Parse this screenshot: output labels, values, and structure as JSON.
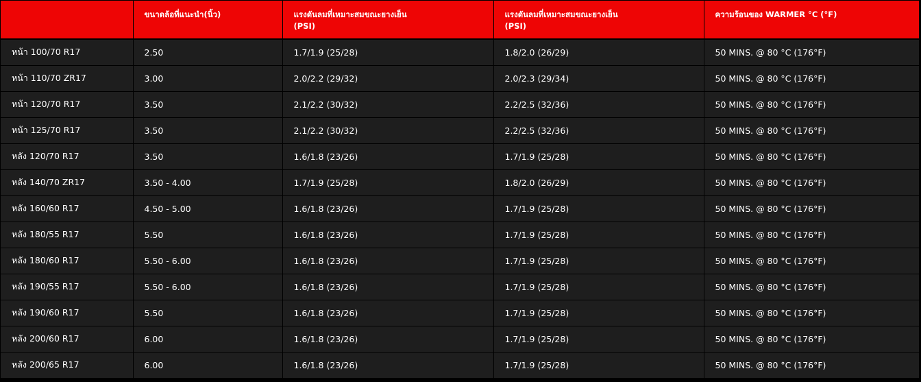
{
  "table": {
    "headers": [
      "",
      "ขนาดล้อที่แนะนำ(นิ้ว)",
      "แรงดันลมที่เหมาะสมขณะยางเย็น\n(PSI)",
      "แรงดันลมที่เหมาะสมขณะยางเย็น\n(PSI)",
      "ความร้อนของ WARMER °C (°F)"
    ],
    "rows": [
      [
        "หน้า 100/70 R17",
        "2.50",
        "1.7/1.9 (25/28)",
        "1.8/2.0 (26/29)",
        "50 MINS. @ 80 °C (176°F)"
      ],
      [
        "หน้า 110/70 ZR17",
        "3.00",
        "2.0/2.2 (29/32)",
        "2.0/2.3 (29/34)",
        "50 MINS. @ 80 °C (176°F)"
      ],
      [
        "หน้า 120/70 R17",
        "3.50",
        "2.1/2.2 (30/32)",
        "2.2/2.5 (32/36)",
        "50 MINS. @ 80 °C (176°F)"
      ],
      [
        "หน้า 125/70 R17",
        "3.50",
        "2.1/2.2 (30/32)",
        "2.2/2.5 (32/36)",
        "50 MINS. @ 80 °C (176°F)"
      ],
      [
        "หลัง 120/70 R17",
        "3.50",
        "1.6/1.8 (23/26)",
        "1.7/1.9 (25/28)",
        "50 MINS. @ 80 °C (176°F)"
      ],
      [
        "หลัง 140/70 ZR17",
        "3.50 - 4.00",
        "1.7/1.9 (25/28)",
        "1.8/2.0 (26/29)",
        "50 MINS. @ 80 °C (176°F)"
      ],
      [
        "หลัง 160/60 R17",
        "4.50 - 5.00",
        "1.6/1.8 (23/26)",
        "1.7/1.9 (25/28)",
        "50 MINS. @ 80 °C (176°F)"
      ],
      [
        "หลัง 180/55 R17",
        "5.50",
        "1.6/1.8 (23/26)",
        "1.7/1.9 (25/28)",
        "50 MINS. @ 80 °C (176°F)"
      ],
      [
        "หลัง 180/60 R17",
        "5.50 - 6.00",
        "1.6/1.8 (23/26)",
        "1.7/1.9 (25/28)",
        "50 MINS. @ 80 °C (176°F)"
      ],
      [
        "หลัง 190/55 R17",
        "5.50 - 6.00",
        "1.6/1.8 (23/26)",
        "1.7/1.9 (25/28)",
        "50 MINS. @ 80 °C (176°F)"
      ],
      [
        "หลัง 190/60 R17",
        "5.50",
        "1.6/1.8 (23/26)",
        "1.7/1.9 (25/28)",
        "50 MINS. @ 80 °C (176°F)"
      ],
      [
        "หลัง 200/60 R17",
        "6.00",
        "1.6/1.8 (23/26)",
        "1.7/1.9 (25/28)",
        "50 MINS. @ 80 °C (176°F)"
      ],
      [
        "หลัง 200/65 R17",
        "6.00",
        "1.6/1.8 (23/26)",
        "1.7/1.9 (25/28)",
        "50 MINS. @ 80 °C (176°F)"
      ]
    ]
  },
  "colors": {
    "header_bg": "#ee0505",
    "row_bg": "#1e1e1e",
    "grid": "#000000",
    "text": "#ffffff"
  }
}
